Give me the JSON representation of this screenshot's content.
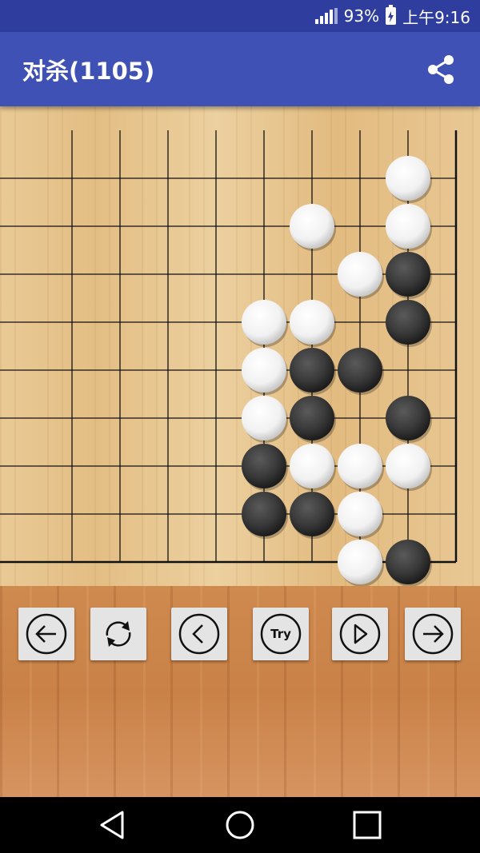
{
  "status_bar": {
    "battery_percent": "93%",
    "time": "上午9:16"
  },
  "app_bar": {
    "title": "对杀(1105)",
    "share_icon": "share-icon"
  },
  "board": {
    "line_color": "#111111",
    "visible_columns": 10,
    "visible_rows": 10,
    "white_stones": [
      [
        8,
        1
      ],
      [
        6,
        2
      ],
      [
        8,
        2
      ],
      [
        7,
        3
      ],
      [
        5,
        4
      ],
      [
        6,
        4
      ],
      [
        5,
        5
      ],
      [
        5,
        6
      ],
      [
        6,
        7
      ],
      [
        7,
        7
      ],
      [
        8,
        7
      ],
      [
        7,
        8
      ],
      [
        7,
        9
      ]
    ],
    "black_stones": [
      [
        8,
        3
      ],
      [
        8,
        4
      ],
      [
        6,
        5
      ],
      [
        7,
        5
      ],
      [
        6,
        6
      ],
      [
        8,
        6
      ],
      [
        5,
        7
      ],
      [
        5,
        8
      ],
      [
        6,
        8
      ],
      [
        8,
        9
      ]
    ]
  },
  "controls": [
    {
      "name": "first-move-button",
      "icon": "arrow-left-icon"
    },
    {
      "name": "reset-button",
      "icon": "rotate-icon"
    },
    {
      "name": "previous-move-button",
      "icon": "chevron-left-icon"
    },
    {
      "name": "try-button",
      "icon": "try-icon",
      "label": "Try"
    },
    {
      "name": "play-button",
      "icon": "play-icon"
    },
    {
      "name": "last-move-button",
      "icon": "arrow-right-icon"
    }
  ],
  "nav_bar": {
    "icons": [
      "back-icon",
      "home-icon",
      "recents-icon"
    ]
  },
  "colors": {
    "status_bar": "#2f3e9e",
    "app_bar": "#3f51b5",
    "button_face": "#e4e4e4"
  }
}
